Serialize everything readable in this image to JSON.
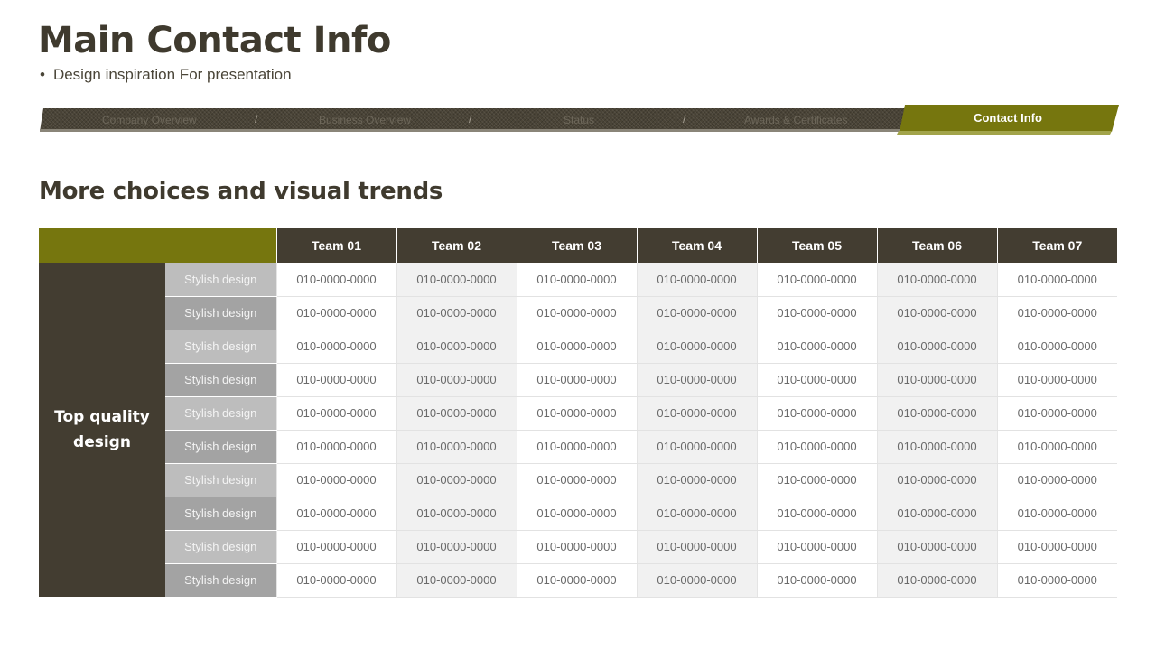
{
  "header": {
    "title": "Main Contact Info",
    "subtitle_bullet": "•",
    "subtitle": "Design inspiration For presentation"
  },
  "nav": {
    "items": [
      "Company Overview",
      "Business Overview",
      "Status",
      "Awards & Certificates"
    ],
    "separator": "/",
    "active": "Contact Info"
  },
  "section": {
    "title": "More choices and visual trends"
  },
  "table": {
    "columns": [
      "Team 01",
      "Team 02",
      "Team 03",
      "Team 04",
      "Team 05",
      "Team 06",
      "Team 07"
    ],
    "group_label": "Top quality design",
    "rows": [
      {
        "label": "Stylish design",
        "values": [
          "010-0000-0000",
          "010-0000-0000",
          "010-0000-0000",
          "010-0000-0000",
          "010-0000-0000",
          "010-0000-0000",
          "010-0000-0000"
        ]
      },
      {
        "label": "Stylish design",
        "values": [
          "010-0000-0000",
          "010-0000-0000",
          "010-0000-0000",
          "010-0000-0000",
          "010-0000-0000",
          "010-0000-0000",
          "010-0000-0000"
        ]
      },
      {
        "label": "Stylish design",
        "values": [
          "010-0000-0000",
          "010-0000-0000",
          "010-0000-0000",
          "010-0000-0000",
          "010-0000-0000",
          "010-0000-0000",
          "010-0000-0000"
        ]
      },
      {
        "label": "Stylish design",
        "values": [
          "010-0000-0000",
          "010-0000-0000",
          "010-0000-0000",
          "010-0000-0000",
          "010-0000-0000",
          "010-0000-0000",
          "010-0000-0000"
        ]
      },
      {
        "label": "Stylish design",
        "values": [
          "010-0000-0000",
          "010-0000-0000",
          "010-0000-0000",
          "010-0000-0000",
          "010-0000-0000",
          "010-0000-0000",
          "010-0000-0000"
        ]
      },
      {
        "label": "Stylish design",
        "values": [
          "010-0000-0000",
          "010-0000-0000",
          "010-0000-0000",
          "010-0000-0000",
          "010-0000-0000",
          "010-0000-0000",
          "010-0000-0000"
        ]
      },
      {
        "label": "Stylish design",
        "values": [
          "010-0000-0000",
          "010-0000-0000",
          "010-0000-0000",
          "010-0000-0000",
          "010-0000-0000",
          "010-0000-0000",
          "010-0000-0000"
        ]
      },
      {
        "label": "Stylish design",
        "values": [
          "010-0000-0000",
          "010-0000-0000",
          "010-0000-0000",
          "010-0000-0000",
          "010-0000-0000",
          "010-0000-0000",
          "010-0000-0000"
        ]
      },
      {
        "label": "Stylish design",
        "values": [
          "010-0000-0000",
          "010-0000-0000",
          "010-0000-0000",
          "010-0000-0000",
          "010-0000-0000",
          "010-0000-0000",
          "010-0000-0000"
        ]
      },
      {
        "label": "Stylish design",
        "values": [
          "010-0000-0000",
          "010-0000-0000",
          "010-0000-0000",
          "010-0000-0000",
          "010-0000-0000",
          "010-0000-0000",
          "010-0000-0000"
        ]
      }
    ]
  },
  "colors": {
    "accent": "#76760e",
    "dark": "#433d31",
    "label_light": "#bdbdbd",
    "label_dark": "#a3a3a3"
  }
}
